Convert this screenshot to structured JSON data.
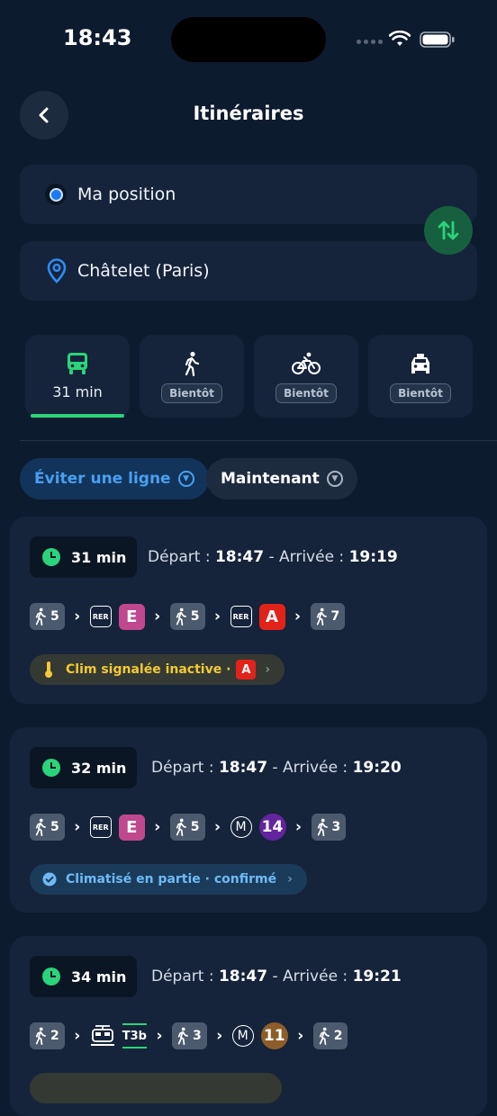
{
  "status": {
    "time": "18:43"
  },
  "header": {
    "title": "Itinéraires"
  },
  "from": {
    "label": "Ma position"
  },
  "to": {
    "label": "Châtelet (Paris)"
  },
  "modes": [
    {
      "icon": "bus-icon",
      "text": "31 min",
      "active": true
    },
    {
      "icon": "walk-icon",
      "text": "Bientôt"
    },
    {
      "icon": "bike-icon",
      "text": "Bientôt"
    },
    {
      "icon": "taxi-icon",
      "text": "Bientôt"
    }
  ],
  "filters": {
    "avoid_line": "Éviter une ligne",
    "when": "Maintenant"
  },
  "labels": {
    "depart": "Départ :",
    "arrivee": "- Arrivée :"
  },
  "routes": [
    {
      "duration": "31 min",
      "depart": "18:47",
      "arrive": "19:19",
      "steps": {
        "walk1": "5",
        "rer1_label": "RER",
        "line1": "E",
        "walk2": "5",
        "rer2_label": "RER",
        "line2": "A",
        "walk3": "7"
      },
      "note": {
        "text": "Clim signalée inactive ·",
        "line": "A"
      }
    },
    {
      "duration": "32 min",
      "depart": "18:47",
      "arrive": "19:20",
      "steps": {
        "walk1": "5",
        "rer1_label": "RER",
        "line1": "E",
        "walk2": "5",
        "metro_label": "M",
        "line2": "14",
        "walk3": "3"
      },
      "note": {
        "text": "Climatisé en partie · confirmé"
      }
    },
    {
      "duration": "34 min",
      "depart": "18:47",
      "arrive": "19:21",
      "steps": {
        "walk1": "2",
        "tram_label": "T3b",
        "walk2": "3",
        "metro_label": "M",
        "line2": "11",
        "walk3": "2"
      }
    }
  ],
  "colors": {
    "accent": "#2bd47a",
    "rer_e": "#c0488f",
    "rer_a": "#e2231a",
    "metro_14": "#62259d",
    "metro_11": "#8d5e2a",
    "link_blue": "#4a9ff0"
  }
}
